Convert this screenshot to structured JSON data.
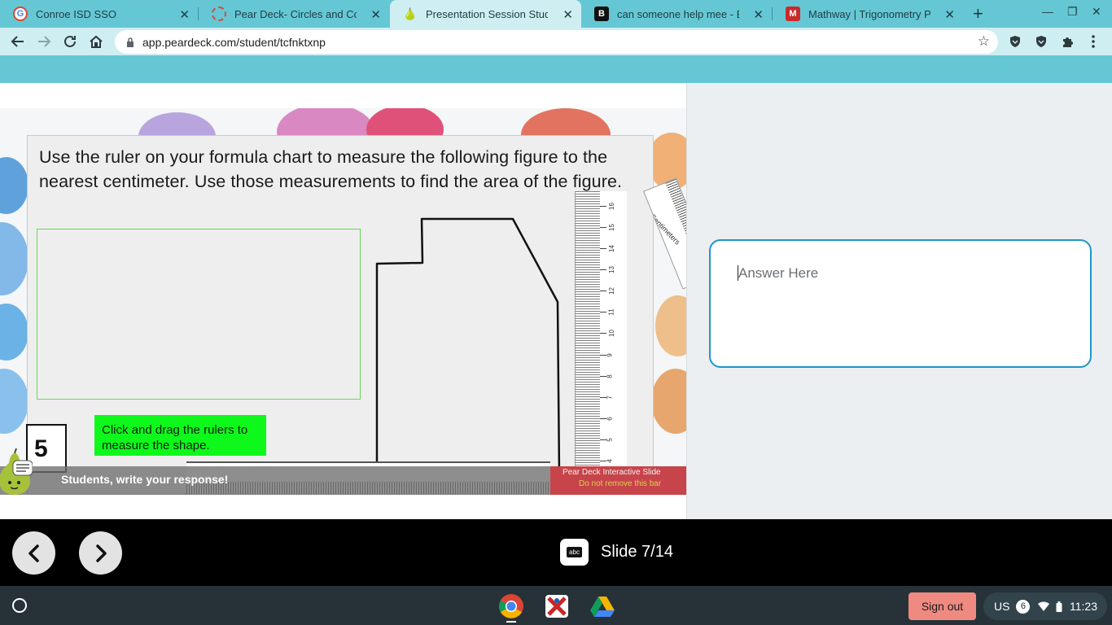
{
  "browser": {
    "tabs": [
      {
        "label": "Conroe ISD SSO",
        "icon": "google-g-icon",
        "active": false
      },
      {
        "label": "Pear Deck- Circles and Compos",
        "icon": "peardeck-loading-icon",
        "active": false
      },
      {
        "label": "Presentation Session Student",
        "icon": "pear-icon",
        "active": true
      },
      {
        "label": "can someone help mee - Brainly",
        "icon": "brainly-icon",
        "active": false
      },
      {
        "label": "Mathway | Trigonometry Proble",
        "icon": "mathway-icon",
        "active": false
      }
    ],
    "new_tab_symbol": "+",
    "url": "app.peardeck.com/student/tcfnktxnp"
  },
  "slide": {
    "instructions": "Use the ruler on your formula chart to measure the following figure to the nearest centimeter.  Use those measurements to find the area of the figure.",
    "note": "Click and drag the rulers to measure the shape.",
    "number": "5",
    "vertical_ruler_numbers": [
      "16",
      "15",
      "14",
      "13",
      "12",
      "11",
      "10",
      "9",
      "8",
      "7",
      "6",
      "5",
      "4"
    ],
    "diag_ruler_label": "Centimeters",
    "bottom_prompt": "Students, write your response!",
    "badge_line1": "Pear Deck Interactive Slide",
    "badge_line2": "Do not remove this bar"
  },
  "answer": {
    "placeholder": "Answer Here"
  },
  "player": {
    "slide_counter": "Slide 7/14",
    "abc_label": "abc"
  },
  "shelf": {
    "sign_out": "Sign out",
    "locale": "US",
    "notifications": "6",
    "time": "11:23"
  },
  "colors": {
    "teal": "#66c7d4",
    "answer_border": "#1e96c8",
    "note_green": "#0ef81b",
    "signout": "#ef8a80"
  }
}
